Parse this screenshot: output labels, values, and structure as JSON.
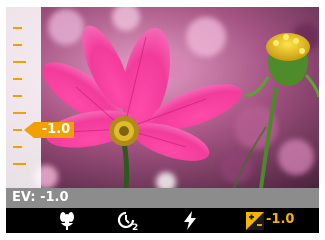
{
  "ev_scale": {
    "marker_value": "-1.0"
  },
  "status_bar": {
    "text": "EV: -1.0"
  },
  "menu": {
    "items": [
      {
        "icon": "macro-flower-icon"
      },
      {
        "icon": "self-timer-2s-icon"
      },
      {
        "icon": "flash-icon"
      },
      {
        "icon": "exposure-compensation-icon",
        "value": "-1.0",
        "selected": true
      }
    ]
  },
  "colors": {
    "accent": "#f0a000",
    "selected_value": "#f5b400",
    "status_bar_bg": "#8c8c8c",
    "menu_bar_bg": "#000000"
  }
}
